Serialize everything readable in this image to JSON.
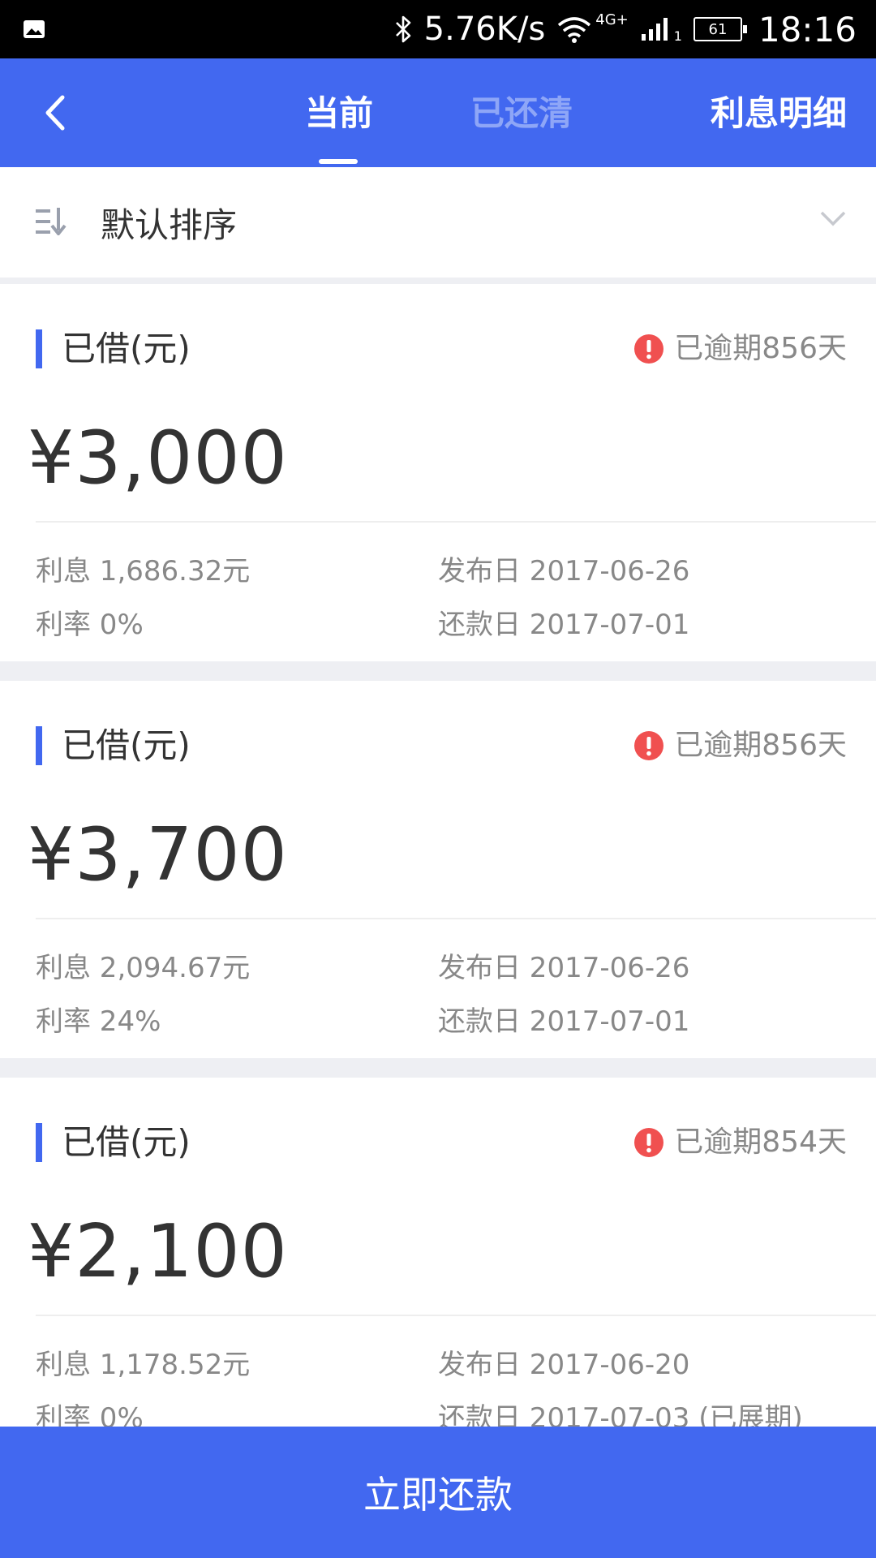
{
  "status_bar": {
    "net_speed": "5.76K/s",
    "network_type": "4G+",
    "sim_slot": "1",
    "battery": "61",
    "time": "18:16"
  },
  "header": {
    "tabs": [
      {
        "label": "当前",
        "active": true
      },
      {
        "label": "已还清",
        "active": false
      }
    ],
    "right_action": "利息明细"
  },
  "sort": {
    "label": "默认排序"
  },
  "loans": [
    {
      "title": "已借(元)",
      "overdue": "已逾期856天",
      "amount": "¥3,000",
      "interest": "利息 1,686.32元",
      "rate": "利率 0%",
      "publish_date": "发布日 2017-06-26",
      "repay_date": "还款日 2017-07-01"
    },
    {
      "title": "已借(元)",
      "overdue": "已逾期856天",
      "amount": "¥3,700",
      "interest": "利息 2,094.67元",
      "rate": "利率 24%",
      "publish_date": "发布日 2017-06-26",
      "repay_date": "还款日 2017-07-01"
    },
    {
      "title": "已借(元)",
      "overdue": "已逾期854天",
      "amount": "¥2,100",
      "interest": "利息 1,178.52元",
      "rate": "利率 0%",
      "publish_date": "发布日 2017-06-20",
      "repay_date": "还款日 2017-07-03 (已展期)"
    }
  ],
  "footer": {
    "repay_button": "立即还款"
  },
  "colors": {
    "accent": "#4268f0",
    "inactive_tab": "#8ea6f7",
    "overdue_icon": "#f05050",
    "background_band": "#eeeff3"
  },
  "icons": {
    "status_left": "image-icon",
    "back": "chevron-left-icon",
    "sort": "sort-icon",
    "dropdown": "chevron-down-icon",
    "overdue": "exclamation-circle-icon"
  }
}
